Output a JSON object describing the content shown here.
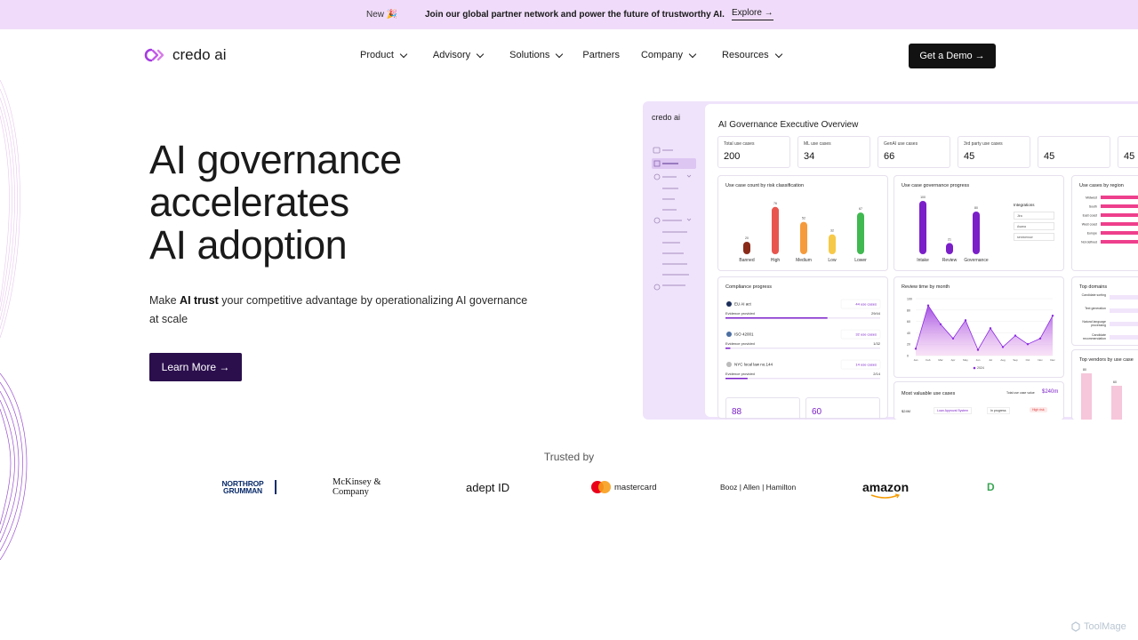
{
  "announcement": {
    "new_label": "New 🎉",
    "message": "Join our global partner network and power the future of trustworthy AI.",
    "explore": "Explore →"
  },
  "nav": {
    "logo_text": "credo ai",
    "menu": [
      "Product",
      "Advisory",
      "Solutions",
      "Partners",
      "Company",
      "Resources"
    ],
    "demo_button": "Get a Demo →"
  },
  "hero": {
    "title_lines": [
      "AI governance",
      "accelerates",
      "AI adoption"
    ],
    "subtitle_pre": "Make ",
    "subtitle_bold": "AI trust",
    "subtitle_post": " your competitive advantage by operationalizing AI governance at scale",
    "cta": "Learn More →"
  },
  "dashboard": {
    "logo": "credo ai",
    "title": "AI Governance Executive Overview",
    "kpis": [
      {
        "label": "Total use cases",
        "value": "200"
      },
      {
        "label": "ML use cases",
        "value": "34"
      },
      {
        "label": "GenAI use cases",
        "value": "66"
      },
      {
        "label": "3rd party use cases",
        "value": "45"
      },
      {
        "label": "",
        "value": "45"
      },
      {
        "label": "",
        "value": "45"
      }
    ],
    "risk_panel": {
      "title": "Use case count by risk classification",
      "categories": [
        "Banned",
        "High",
        "Medium",
        "Low",
        "Lower"
      ],
      "values": [
        20,
        76,
        52,
        32,
        67
      ],
      "colors": [
        "#8a2b1a",
        "#e8554e",
        "#f59b3c",
        "#f7c948",
        "#3fb950"
      ]
    },
    "progress_panel": {
      "title": "Use case governance progress",
      "categories": [
        "Intake",
        "Review",
        "Governance"
      ],
      "values": [
        100,
        21,
        80
      ],
      "integrations_label": "Integrations",
      "integrations": [
        "Jira",
        "Asana",
        "servicenow"
      ]
    },
    "region_panel": {
      "title": "Use cases by region",
      "regions": [
        "Midwest",
        "South",
        "East coast",
        "West coast",
        "Europe",
        "Not defined"
      ]
    },
    "compliance_panel": {
      "title": "Compliance progress",
      "items": [
        {
          "name": "EU AI act",
          "count": "44 use cases",
          "evidence": "Evidence provided",
          "ratio": "29/44"
        },
        {
          "name": "ISO 42001",
          "count": "32 use cases",
          "evidence": "Evidence provided",
          "ratio": "1/32"
        },
        {
          "name": "NYC local law no.144",
          "count": "14 use cases",
          "evidence": "Evidence provided",
          "ratio": "2/14"
        }
      ],
      "mini_values": [
        "88",
        "60"
      ]
    },
    "review_panel": {
      "title": "Review time by month",
      "y_ticks": [
        "100",
        "80",
        "60",
        "40",
        "20",
        "0"
      ],
      "months": [
        "Jan",
        "Feb",
        "Mar",
        "Apr",
        "May",
        "Jun",
        "Jul",
        "Aug",
        "Sep",
        "Oct",
        "Nov",
        "Dec"
      ],
      "values": [
        12,
        88,
        55,
        30,
        62,
        10,
        48,
        15,
        35,
        20,
        30,
        70
      ],
      "legend": "2024"
    },
    "domains_panel": {
      "title": "Top domains",
      "domains": [
        "Candidate sorting",
        "Text generation",
        "Natural language processing",
        "Candidate recommendation"
      ]
    },
    "valuable_panel": {
      "title": "Most valuable use cases",
      "total_label": "Total use case value",
      "total_value": "$240m",
      "row_value": "$24M",
      "row_name": "Loan Approval System",
      "row_status": "In progress",
      "row_risk": "High risk"
    },
    "vendors_panel": {
      "title": "Top vendors by use case",
      "values": [
        "80",
        "60"
      ]
    }
  },
  "trusted": {
    "label": "Trusted by",
    "logos": [
      "NORTHROP GRUMMAN",
      "McKinsey & Company",
      "adept ID",
      "mastercard",
      "Booz | Allen | Hamilton",
      "amazon",
      "D"
    ]
  },
  "watermark": "ToolMage",
  "colors": {
    "announcement_bg": "#f0dcfa",
    "cta_bg": "#2b0f4d",
    "demo_bg": "#121212",
    "accent_purple": "#7b1fc9",
    "pink": "#ee3f8c"
  }
}
